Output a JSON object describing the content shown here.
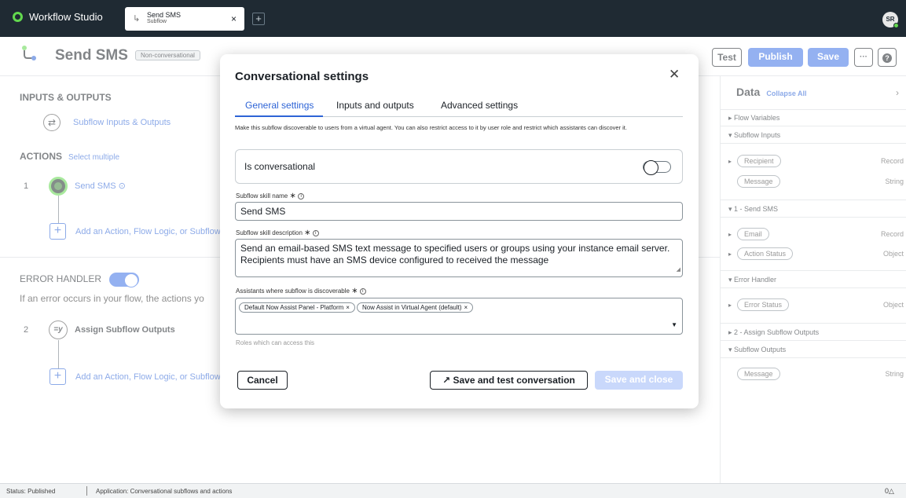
{
  "app": {
    "name": "Workflow Studio",
    "avatar": "SR"
  },
  "doc_tab": {
    "title": "Send SMS",
    "subtitle": "Subflow",
    "close": "×"
  },
  "header": {
    "title": "Send SMS",
    "badge": "Non-conversational",
    "test": "Test",
    "publish": "Publish",
    "save": "Save",
    "more": "···",
    "help": "?"
  },
  "left": {
    "io_heading": "INPUTS & OUTPUTS",
    "io_link": "Subflow Inputs & Outputs",
    "actions_heading": "ACTIONS",
    "select_multiple": "Select multiple",
    "step1": {
      "num": "1",
      "label": "Send SMS",
      "info": "⊙"
    },
    "add_label": "Add an Action, Flow Logic, or Subflow",
    "error_heading": "ERROR HANDLER",
    "error_text": "If an error occurs in your flow, the actions yo",
    "step2": {
      "num": "2",
      "icon": "=y",
      "label": "Assign Subflow Outputs"
    }
  },
  "data_panel": {
    "title": "Data",
    "collapse": "Collapse All",
    "sections": {
      "flow_vars": "Flow Variables",
      "subflow_inputs": "Subflow Inputs",
      "send_sms": "1 - Send SMS",
      "error_handler": "Error Handler",
      "assign": "2 - Assign Subflow Outputs",
      "subflow_outputs": "Subflow Outputs"
    },
    "pills": {
      "recipient": {
        "label": "Recipient",
        "type": "Record"
      },
      "message_in": {
        "label": "Message",
        "type": "String"
      },
      "email": {
        "label": "Email",
        "type": "Record"
      },
      "action_status": {
        "label": "Action Status",
        "type": "Object"
      },
      "error_status": {
        "label": "Error Status",
        "type": "Object"
      },
      "message_out": {
        "label": "Message",
        "type": "String"
      }
    }
  },
  "status": {
    "left": "Status: Published",
    "app": "Application: Conversational subflows and actions",
    "right": "0△"
  },
  "modal": {
    "title": "Conversational settings",
    "tabs": [
      "General settings",
      "Inputs and outputs",
      "Advanced settings"
    ],
    "description": "Make this subflow discoverable to users from a virtual agent. You can also restrict access to it by user role and restrict which assistants can discover it.",
    "is_conversational": "Is conversational",
    "skill_name_label": "Subflow skill name",
    "skill_name_value": "Send SMS",
    "skill_desc_label": "Subflow skill description",
    "skill_desc_value": "Send an email-based SMS text message to specified users or groups using your instance email server. Recipients must have an SMS device configured to received the message",
    "assistants_label": "Assistants where subflow is discoverable",
    "assistants": [
      "Default Now Assist Panel - Platform",
      "Now Assist in Virtual Agent (default)"
    ],
    "roles_label": "Roles which can access this",
    "cancel": "Cancel",
    "save_test": "Save and test conversation",
    "save_close": "Save and close"
  }
}
